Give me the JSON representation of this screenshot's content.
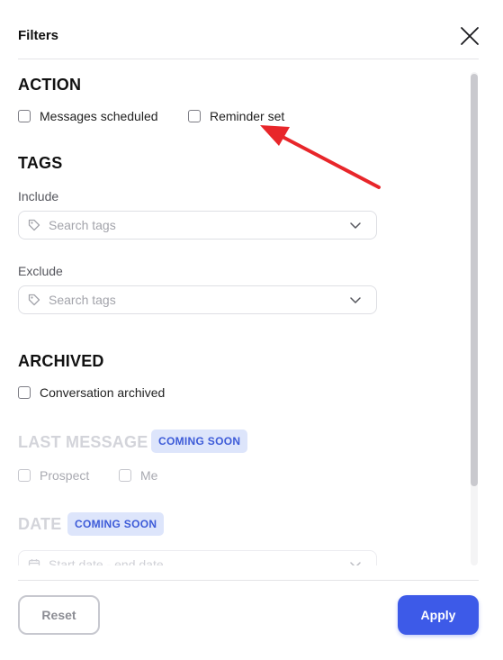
{
  "header": {
    "title": "Filters",
    "close_icon": "close-icon"
  },
  "sections": {
    "action": {
      "title": "ACTION",
      "options": [
        {
          "label": "Messages scheduled",
          "checked": false
        },
        {
          "label": "Reminder set",
          "checked": false
        }
      ]
    },
    "tags": {
      "title": "TAGS",
      "include": {
        "label": "Include",
        "placeholder": "Search tags",
        "icon": "tag-icon"
      },
      "exclude": {
        "label": "Exclude",
        "placeholder": "Search tags",
        "icon": "tag-icon"
      }
    },
    "archived": {
      "title": "ARCHIVED",
      "options": [
        {
          "label": "Conversation archived",
          "checked": false
        }
      ]
    },
    "last_message": {
      "title": "LAST MESSAGE",
      "badge": "COMING SOON",
      "options": [
        {
          "label": "Prospect",
          "checked": false
        },
        {
          "label": "Me",
          "checked": false
        }
      ]
    },
    "date": {
      "title": "DATE",
      "badge": "COMING SOON",
      "placeholder": "Start date - end date",
      "icon": "calendar-icon"
    }
  },
  "footer": {
    "reset_label": "Reset",
    "apply_label": "Apply"
  },
  "colors": {
    "accent": "#3d5ae8",
    "badge_bg": "#dde5fb",
    "badge_text": "#3d5bd8",
    "annotation_arrow": "#e8262a"
  }
}
